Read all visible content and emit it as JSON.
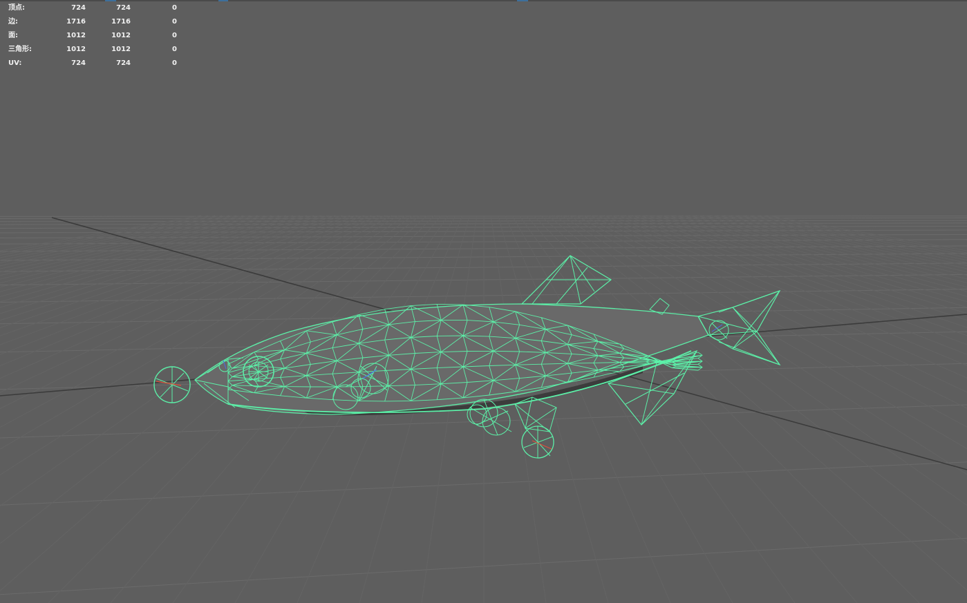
{
  "heads_up_display": {
    "poly_count": [
      {
        "label": "顶点:",
        "values": [
          "724",
          "724",
          "0"
        ]
      },
      {
        "label": "边:",
        "values": [
          "1716",
          "1716",
          "0"
        ]
      },
      {
        "label": "面:",
        "values": [
          "1012",
          "1012",
          "0"
        ]
      },
      {
        "label": "三角形:",
        "values": [
          "1012",
          "1012",
          "0"
        ]
      },
      {
        "label": "UV:",
        "values": [
          "724",
          "724",
          "0"
        ]
      }
    ]
  },
  "colors": {
    "viewport_background": "#5e5e5e",
    "grid_line": "#6a6a6a",
    "axis_line": "#3a3a3a",
    "wireframe": "#5cf0a8",
    "joint_red": "#e0503a",
    "joint_blue": "#4a6ee8"
  },
  "scene_object": "fish-wireframe-model"
}
